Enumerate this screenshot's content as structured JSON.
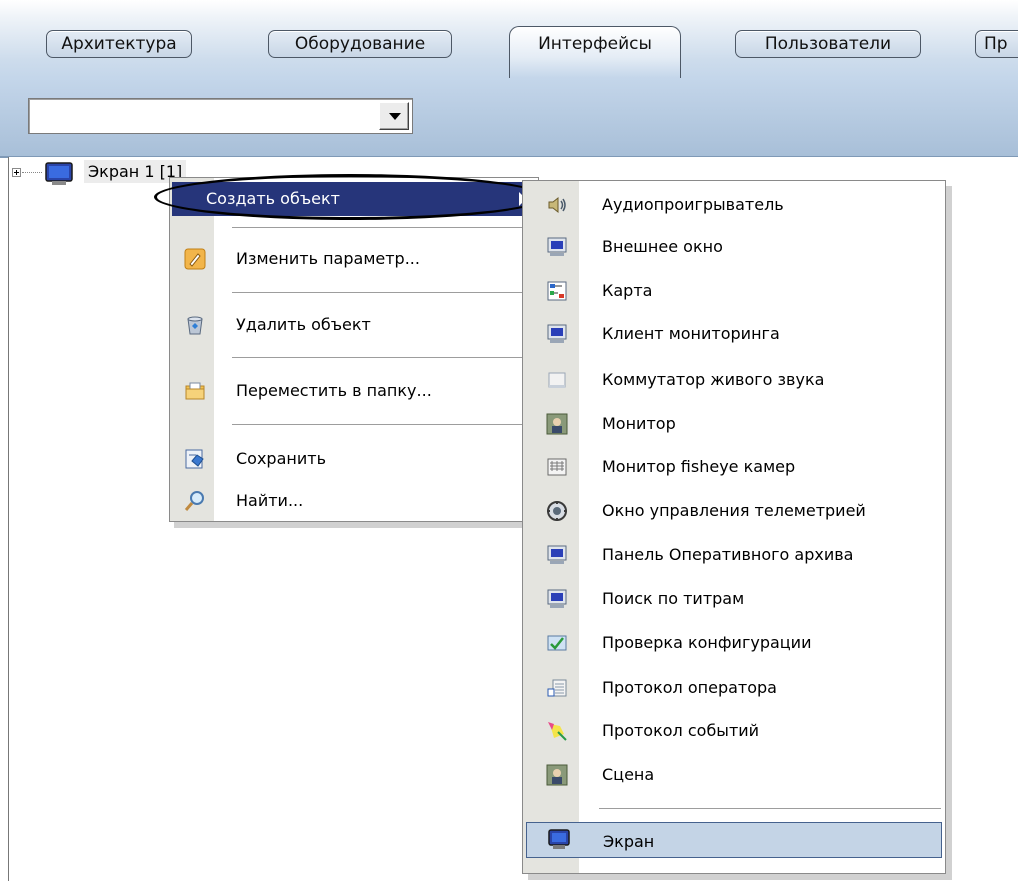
{
  "tabs": [
    {
      "label": "Архитектура",
      "active": false
    },
    {
      "label": "Оборудование",
      "active": false
    },
    {
      "label": "Интерфейсы",
      "active": true
    },
    {
      "label": "Пользователи",
      "active": false
    },
    {
      "label": "Пр",
      "active": false
    }
  ],
  "combo": {
    "value": ""
  },
  "tree": {
    "node_label": "Экран 1 [1]"
  },
  "context_menu": {
    "items": [
      {
        "label": "Создать объект",
        "icon": "none",
        "highlighted": true,
        "has_submenu": true
      },
      {
        "label": "Изменить параметр...",
        "icon": "edit-icon"
      },
      {
        "label": "Удалить объект",
        "icon": "recycle-bin-icon"
      },
      {
        "label": "Переместить в папку...",
        "icon": "folder-move-icon"
      },
      {
        "label": "Сохранить",
        "icon": "save-icon"
      },
      {
        "label": "Найти...",
        "icon": "find-icon"
      }
    ]
  },
  "submenu": {
    "items": [
      {
        "label": "Аудиопроигрыватель",
        "icon": "speaker-icon"
      },
      {
        "label": "Внешнее окно",
        "icon": "monitor-icon"
      },
      {
        "label": "Карта",
        "icon": "map-icon"
      },
      {
        "label": "Клиент мониторинга",
        "icon": "monitor-icon"
      },
      {
        "label": "Коммутатор живого звука",
        "icon": "window-icon"
      },
      {
        "label": "Монитор",
        "icon": "video-monitor-icon"
      },
      {
        "label": "Монитор fisheye камер",
        "icon": "fisheye-icon"
      },
      {
        "label": "Окно управления телеметрией",
        "icon": "ptz-icon"
      },
      {
        "label": "Панель Оперативного архива",
        "icon": "monitor-icon"
      },
      {
        "label": "Поиск по титрам",
        "icon": "monitor-icon"
      },
      {
        "label": "Проверка конфигурации",
        "icon": "config-check-icon"
      },
      {
        "label": "Протокол оператора",
        "icon": "operator-log-icon"
      },
      {
        "label": "Протокол событий",
        "icon": "event-log-icon"
      },
      {
        "label": "Сцена",
        "icon": "scene-icon"
      },
      {
        "label": "Экран",
        "icon": "screen-icon",
        "highlighted": true
      }
    ]
  },
  "colors": {
    "menu_highlight": "#26357a",
    "submenu_highlight": "#c4d4e6",
    "band_light": "#c4d6ea"
  }
}
